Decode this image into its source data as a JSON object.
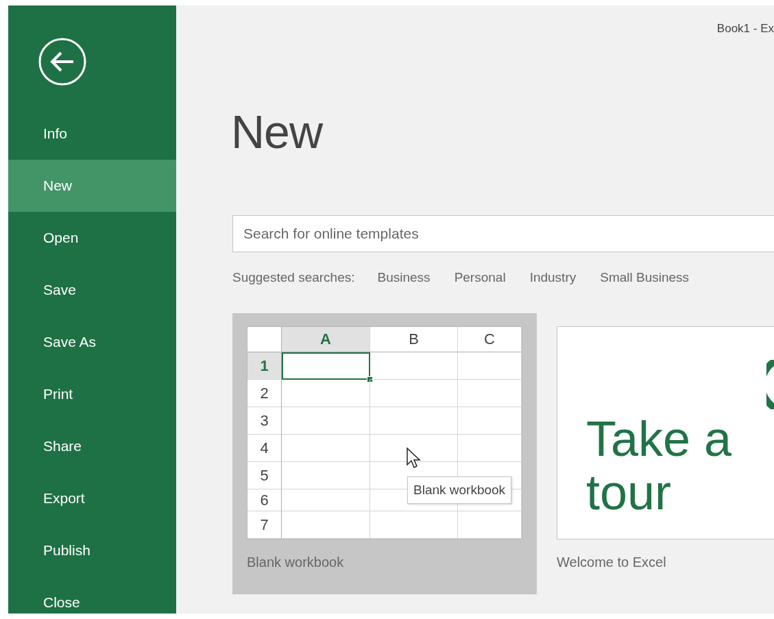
{
  "window": {
    "title": "Book1 - Ex"
  },
  "sidebar": {
    "items": [
      {
        "label": "Info",
        "selected": false
      },
      {
        "label": "New",
        "selected": true
      },
      {
        "label": "Open",
        "selected": false
      },
      {
        "label": "Save",
        "selected": false
      },
      {
        "label": "Save As",
        "selected": false
      },
      {
        "label": "Print",
        "selected": false
      },
      {
        "label": "Share",
        "selected": false
      },
      {
        "label": "Export",
        "selected": false
      },
      {
        "label": "Publish",
        "selected": false
      },
      {
        "label": "Close",
        "selected": false
      }
    ]
  },
  "heading": "New",
  "search": {
    "placeholder": "Search for online templates"
  },
  "suggested_searches": {
    "label": "Suggested searches:",
    "links": [
      "Business",
      "Personal",
      "Industry",
      "Small Business"
    ]
  },
  "templates": [
    {
      "kind": "blank",
      "selected": true,
      "caption": "Blank workbook",
      "tooltip": "Blank workbook",
      "columns": [
        {
          "label": "A",
          "selected": true
        },
        {
          "label": "B",
          "selected": false
        },
        {
          "label": "C",
          "selected": false
        }
      ],
      "rows": [
        {
          "label": "1",
          "selected": true
        },
        {
          "label": "2",
          "selected": false
        },
        {
          "label": "3",
          "selected": false
        },
        {
          "label": "4",
          "selected": false
        },
        {
          "label": "5",
          "selected": false
        },
        {
          "label": "6",
          "selected": false
        },
        {
          "label": "7",
          "selected": false
        }
      ]
    },
    {
      "kind": "tour",
      "selected": false,
      "headline": "Take a tour",
      "caption": "Welcome to Excel"
    }
  ]
}
